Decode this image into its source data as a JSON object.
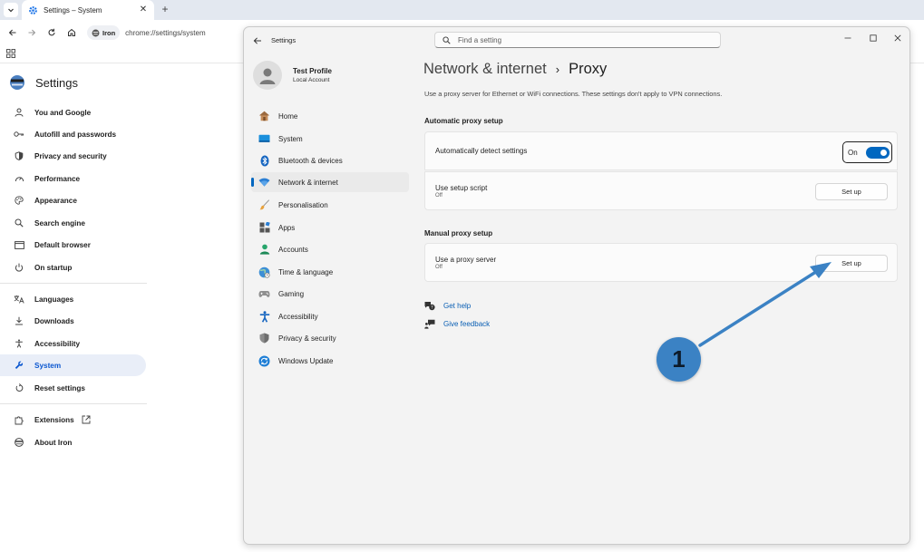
{
  "browser": {
    "tab_title": "Settings – System",
    "site_chip": "Iron",
    "url": "chrome://settings/system"
  },
  "chrome_settings": {
    "title": "Settings",
    "items": [
      {
        "label": "You and Google",
        "icon": "person-icon"
      },
      {
        "label": "Autofill and passwords",
        "icon": "key-icon"
      },
      {
        "label": "Privacy and security",
        "icon": "shield-icon"
      },
      {
        "label": "Performance",
        "icon": "speedometer-icon"
      },
      {
        "label": "Appearance",
        "icon": "palette-icon"
      },
      {
        "label": "Search engine",
        "icon": "search-icon"
      },
      {
        "label": "Default browser",
        "icon": "browser-window-icon"
      },
      {
        "label": "On startup",
        "icon": "power-icon"
      },
      {
        "label": "Languages",
        "icon": "translate-icon"
      },
      {
        "label": "Downloads",
        "icon": "download-icon"
      },
      {
        "label": "Accessibility",
        "icon": "accessibility-icon"
      },
      {
        "label": "System",
        "icon": "wrench-icon"
      },
      {
        "label": "Reset settings",
        "icon": "reset-icon"
      },
      {
        "label": "Extensions",
        "icon": "puzzle-icon"
      },
      {
        "label": "About Iron",
        "icon": "iron-logo-icon"
      }
    ],
    "active_item": "System"
  },
  "win_settings": {
    "app_title": "Settings",
    "search_placeholder": "Find a setting",
    "profile": {
      "name": "Test Profile",
      "subtitle": "Local Account"
    },
    "nav": [
      {
        "label": "Home",
        "icon": "home-icon"
      },
      {
        "label": "System",
        "icon": "monitor-icon"
      },
      {
        "label": "Bluetooth & devices",
        "icon": "bluetooth-icon"
      },
      {
        "label": "Network & internet",
        "icon": "wifi-icon"
      },
      {
        "label": "Personalisation",
        "icon": "brush-icon"
      },
      {
        "label": "Apps",
        "icon": "apps-icon"
      },
      {
        "label": "Accounts",
        "icon": "account-icon"
      },
      {
        "label": "Time & language",
        "icon": "globe-clock-icon"
      },
      {
        "label": "Gaming",
        "icon": "gamepad-icon"
      },
      {
        "label": "Accessibility",
        "icon": "accessibility-icon"
      },
      {
        "label": "Privacy & security",
        "icon": "shield-icon"
      },
      {
        "label": "Windows Update",
        "icon": "update-icon"
      }
    ],
    "active_nav": "Network & internet",
    "breadcrumb": {
      "parent": "Network & internet",
      "separator": "›",
      "current": "Proxy"
    },
    "description": "Use a proxy server for Ethernet or WiFi connections. These settings don't apply to VPN connections.",
    "auto_section": {
      "title": "Automatic proxy setup",
      "detect": {
        "label": "Automatically detect settings",
        "toggle_label": "On",
        "toggle_on": true
      },
      "script": {
        "label": "Use setup script",
        "status": "Off",
        "button": "Set up"
      }
    },
    "manual_section": {
      "title": "Manual proxy setup",
      "proxy": {
        "label": "Use a proxy server",
        "status": "Off",
        "button": "Set up"
      }
    },
    "links": {
      "help": "Get help",
      "feedback": "Give feedback"
    }
  },
  "annotation": {
    "number": "1",
    "color": "#3b82c4"
  }
}
